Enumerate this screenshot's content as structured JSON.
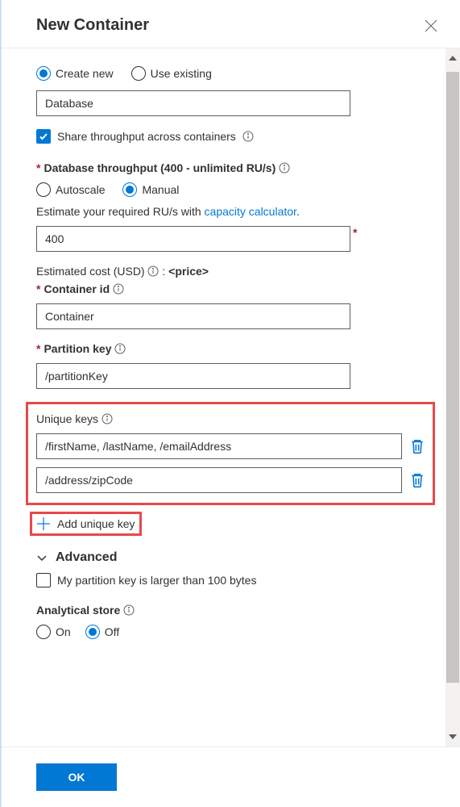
{
  "header": {
    "title": "New Container"
  },
  "database": {
    "create_new_label": "Create new",
    "use_existing_label": "Use existing",
    "name_value": "Database",
    "share_throughput_label": "Share throughput across containers"
  },
  "throughput": {
    "label": "Database throughput (400 - unlimited RU/s)",
    "autoscale_label": "Autoscale",
    "manual_label": "Manual",
    "estimate_prefix": "Estimate your required RU/s with ",
    "estimate_link": "capacity calculator",
    "estimate_suffix": ".",
    "value": "400",
    "cost_label": "Estimated cost (USD) ",
    "cost_value": "<price>"
  },
  "container": {
    "id_label": "Container id",
    "id_value": "Container",
    "partition_label": "Partition key",
    "partition_value": "/partitionKey"
  },
  "unique_keys": {
    "label": "Unique keys",
    "items": [
      "/firstName, /lastName, /emailAddress",
      "/address/zipCode"
    ],
    "add_label": "Add unique key"
  },
  "advanced": {
    "label": "Advanced",
    "large_partition_label": "My partition key is larger than 100 bytes"
  },
  "analytical": {
    "label": "Analytical store",
    "on_label": "On",
    "off_label": "Off"
  },
  "footer": {
    "ok_label": "OK"
  }
}
